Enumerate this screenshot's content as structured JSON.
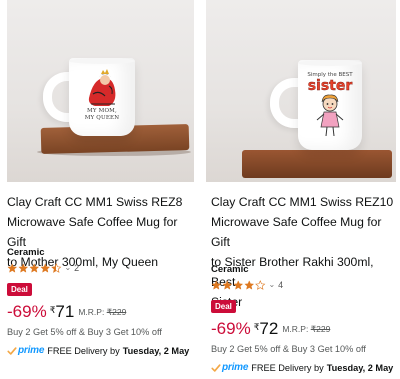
{
  "products": [
    {
      "image_alt": "Mug with My Mom, My Queen print",
      "mug_text": [
        "MY MOM,",
        "MY QUEEN"
      ],
      "title_lines": [
        "Clay Craft CC MM1 Swiss REZ8",
        "Microwave Safe Coffee Mug for Gift",
        "to Mother 300ml, My Queen"
      ],
      "brand": "Ceramic",
      "rating": 4.5,
      "review_count": "2",
      "deal_label": "Deal",
      "discount": "-69%",
      "currency": "₹",
      "price": "71",
      "mrp_label": "M.R.P:",
      "mrp": "₹229",
      "offer": "Buy 2 Get 5% off & Buy 3 Get 10% off",
      "prime_label": "prime",
      "delivery_text": "FREE Delivery by",
      "delivery_date": "Tuesday, 2 May"
    },
    {
      "image_alt": "Mug with Simply the Best Sister print",
      "mug_text": [
        "Simply the BEST",
        "sister"
      ],
      "title_lines": [
        "Clay Craft CC MM1 Swiss REZ10",
        "Microwave Safe Coffee Mug for Gift",
        "to Sister Brother Rakhi 300ml, Best",
        "Sister"
      ],
      "brand": "Ceramic",
      "rating": 4.0,
      "review_count": "4",
      "deal_label": "Deal",
      "discount": "-69%",
      "currency": "₹",
      "price": "72",
      "mrp_label": "M.R.P:",
      "mrp": "₹229",
      "offer": "Buy 2 Get 5% off & Buy 3 Get 10% off",
      "prime_label": "prime",
      "delivery_text": "FREE Delivery by",
      "delivery_date": "Tuesday, 2 May"
    }
  ],
  "colors": {
    "deal_badge": "#cc0c39",
    "discount": "#cc0c39",
    "star": "#de7921",
    "prime": "#1399ff"
  },
  "icons": {
    "star": "star-icon",
    "chevron": "chevron-down-icon",
    "prime_check": "prime-check-icon"
  }
}
